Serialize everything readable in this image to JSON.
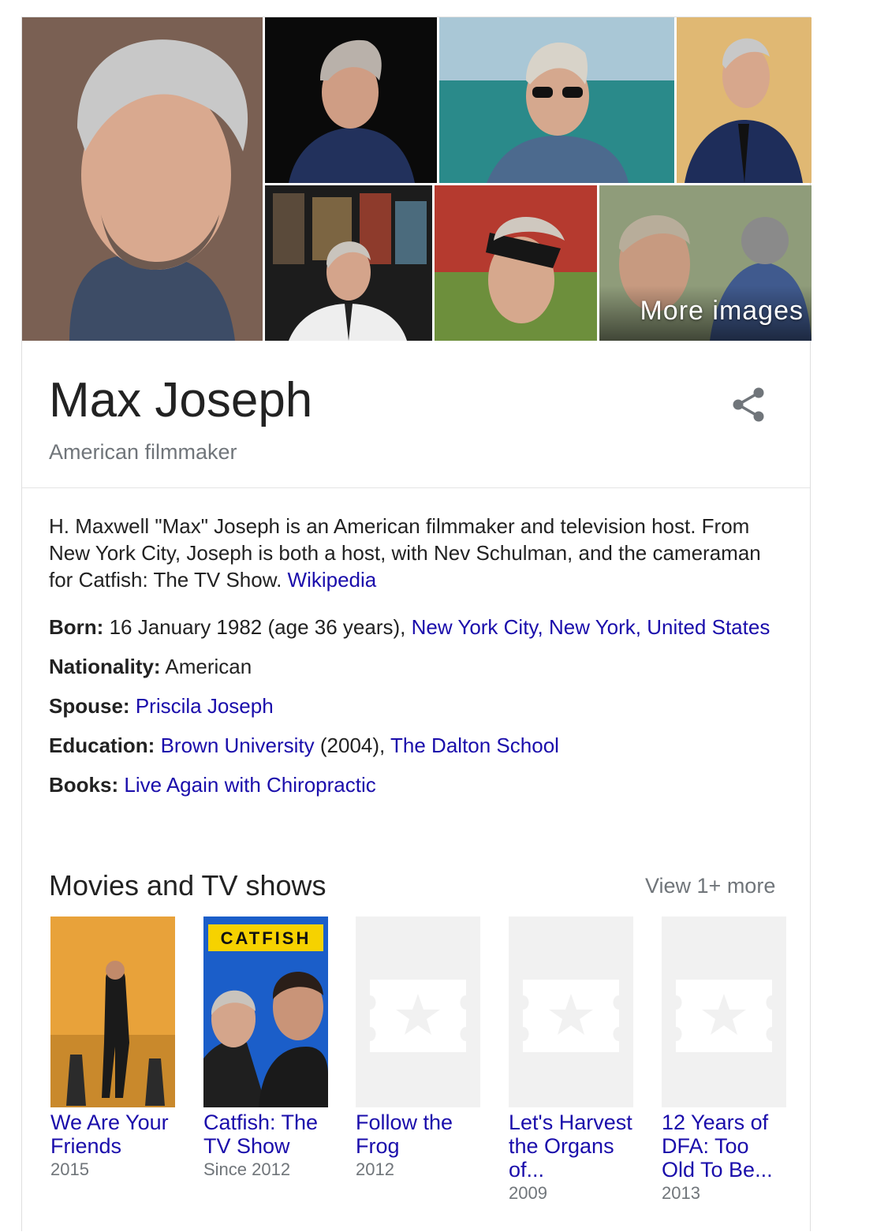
{
  "mosaic": {
    "more_images_label": "More images"
  },
  "entity": {
    "name": "Max Joseph",
    "subtitle": "American filmmaker"
  },
  "description": {
    "text": "H. Maxwell \"Max\" Joseph is an American filmmaker and television host. From New York City, Joseph is both a host, with Nev Schulman, and the cameraman for Catfish: The TV Show.",
    "source": "Wikipedia"
  },
  "facts": {
    "born_label": "Born:",
    "born_text": "16 January 1982 (age 36 years),",
    "born_place": "New York City, New York, United States",
    "nationality_label": "Nationality:",
    "nationality_value": "American",
    "spouse_label": "Spouse:",
    "spouse_value": "Priscila Joseph",
    "education_label": "Education:",
    "education_1": "Brown University",
    "education_1_year": "(2004),",
    "education_2": "The Dalton School",
    "books_label": "Books:",
    "books_value": "Live Again with Chiropractic"
  },
  "movies": {
    "section_title": "Movies and TV shows",
    "view_more": "View 1+ more",
    "items": [
      {
        "title": "We Are Your Friends",
        "year": "2015"
      },
      {
        "title": "Catfish: The TV Show",
        "year": "Since 2012",
        "poster_text": "CATFISH"
      },
      {
        "title": "Follow the Frog",
        "year": "2012"
      },
      {
        "title": "Let's Harvest the Organs of...",
        "year": "2009"
      },
      {
        "title": "12 Years of DFA: Too Old To Be...",
        "year": "2013"
      }
    ]
  },
  "colors": {
    "link": "#1a0dab",
    "muted": "#70757a",
    "placeholder": "#f1f1f1",
    "catfish_blue": "#1b5ec9"
  }
}
